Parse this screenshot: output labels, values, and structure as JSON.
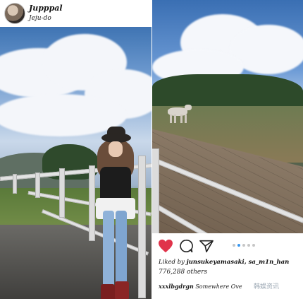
{
  "left_post": {
    "username": "Jupppal",
    "location": "Jeju-do"
  },
  "right_post": {
    "liked_by_prefix": "Liked by",
    "liked_by_users": "junsukeyamasaki, sa_m1n_han",
    "likes_count": "776,288 others",
    "caption_user": "xxxlbgdrgn",
    "caption_text": "Somewhere Ove",
    "carousel_active_index": 2,
    "carousel_total": 5,
    "watermark": "韩娱资讯"
  },
  "icons": {
    "like": "heart-icon",
    "comment": "comment-icon",
    "share": "share-icon"
  },
  "colors": {
    "like_active": "#e0334a",
    "carousel_active": "#3897f0"
  }
}
